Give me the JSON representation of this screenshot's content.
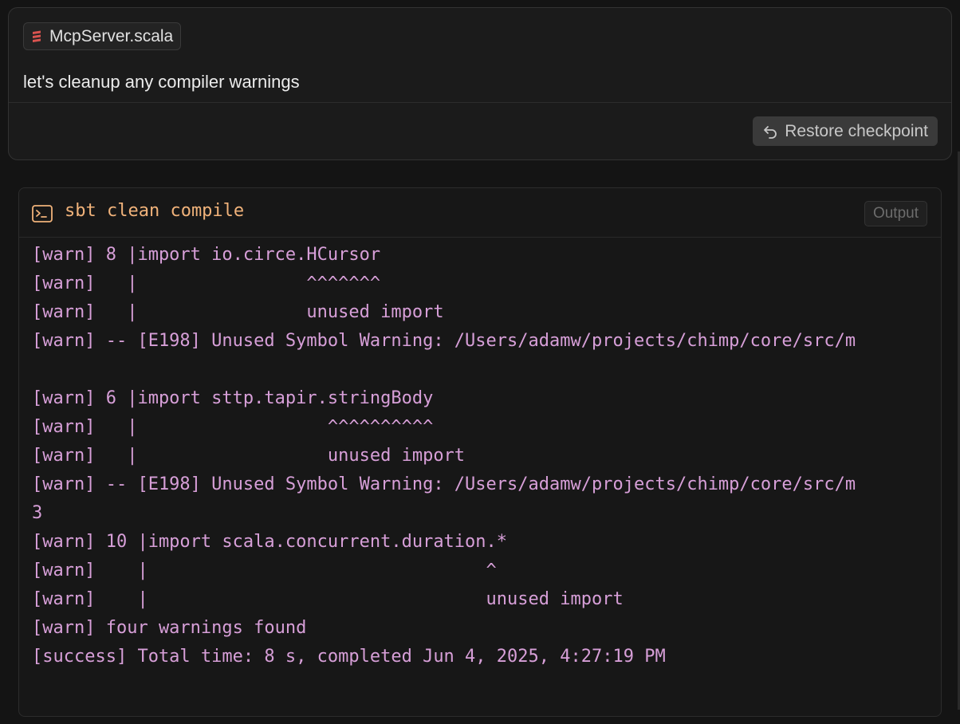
{
  "message": {
    "file_chip": {
      "label": "McpServer.scala",
      "icon": "scala-file-icon",
      "icon_color": "#d9534f"
    },
    "prompt": "let's cleanup any compiler warnings",
    "restore_button": {
      "label": "Restore checkpoint",
      "icon": "undo-icon"
    }
  },
  "terminal": {
    "icon": "terminal-icon",
    "command": "sbt clean compile",
    "badge": "Output",
    "colors": {
      "command": "#f0b27a",
      "output": "#d79fd8"
    },
    "lines": [
      "[warn] 8 |import io.circe.HCursor",
      "[warn]   |                ^^^^^^^",
      "[warn]   |                unused import",
      "[warn] -- [E198] Unused Symbol Warning: /Users/adamw/projects/chimp/core/src/m",
      "",
      "[warn] 6 |import sttp.tapir.stringBody",
      "[warn]   |                  ^^^^^^^^^^",
      "[warn]   |                  unused import",
      "[warn] -- [E198] Unused Symbol Warning: /Users/adamw/projects/chimp/core/src/m",
      "3",
      "[warn] 10 |import scala.concurrent.duration.*",
      "[warn]    |                                ^",
      "[warn]    |                                unused import",
      "[warn] four warnings found",
      "[success] Total time: 8 s, completed Jun 4, 2025, 4:27:19 PM"
    ]
  }
}
